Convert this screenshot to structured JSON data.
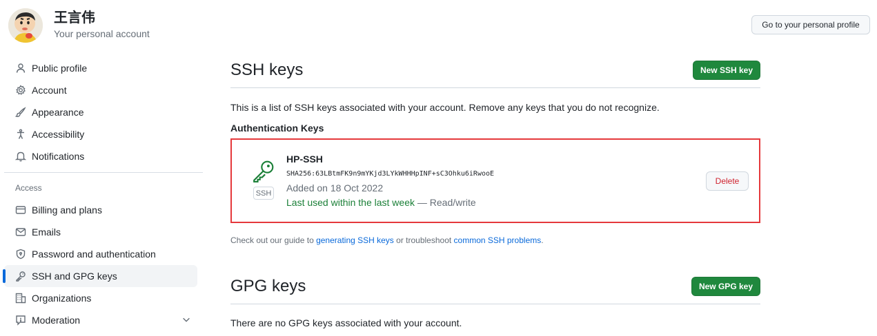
{
  "header": {
    "user_name": "王言伟",
    "account_label": "Your personal account",
    "profile_button": "Go to your personal profile"
  },
  "sidebar": {
    "items": [
      {
        "label": "Public profile",
        "icon": "person-icon"
      },
      {
        "label": "Account",
        "icon": "gear-icon"
      },
      {
        "label": "Appearance",
        "icon": "paintbrush-icon"
      },
      {
        "label": "Accessibility",
        "icon": "accessibility-icon"
      },
      {
        "label": "Notifications",
        "icon": "bell-icon"
      }
    ],
    "access_heading": "Access",
    "access_items": [
      {
        "label": "Billing and plans",
        "icon": "credit-card-icon"
      },
      {
        "label": "Emails",
        "icon": "mail-icon"
      },
      {
        "label": "Password and authentication",
        "icon": "shield-lock-icon"
      },
      {
        "label": "SSH and GPG keys",
        "icon": "key-icon",
        "active": true
      },
      {
        "label": "Organizations",
        "icon": "organization-icon"
      },
      {
        "label": "Moderation",
        "icon": "report-icon"
      }
    ]
  },
  "ssh": {
    "title": "SSH keys",
    "new_button": "New SSH key",
    "description": "This is a list of SSH keys associated with your account. Remove any keys that you do not recognize.",
    "auth_heading": "Authentication Keys",
    "key": {
      "name": "HP-SSH",
      "fingerprint": "SHA256:63LBtmFK9n9mYKjd3LYkWHHHpINF+sC3Ohku6iRwooE",
      "added": "Added on 18 Oct 2022",
      "last_used": "Last used within the last week",
      "access": " — Read/write",
      "badge": "SSH",
      "delete_button": "Delete"
    },
    "guide_prefix": "Check out our guide to ",
    "guide_link1": "generating SSH keys",
    "guide_middle": " or troubleshoot ",
    "guide_link2": "common SSH problems",
    "guide_suffix": "."
  },
  "gpg": {
    "title": "GPG keys",
    "new_button": "New GPG key",
    "empty_text": "There are no GPG keys associated with your account."
  },
  "colors": {
    "accent_green": "#1f883d",
    "highlight_red": "#e5383b",
    "link_blue": "#0969da",
    "danger_red": "#cf222e"
  }
}
